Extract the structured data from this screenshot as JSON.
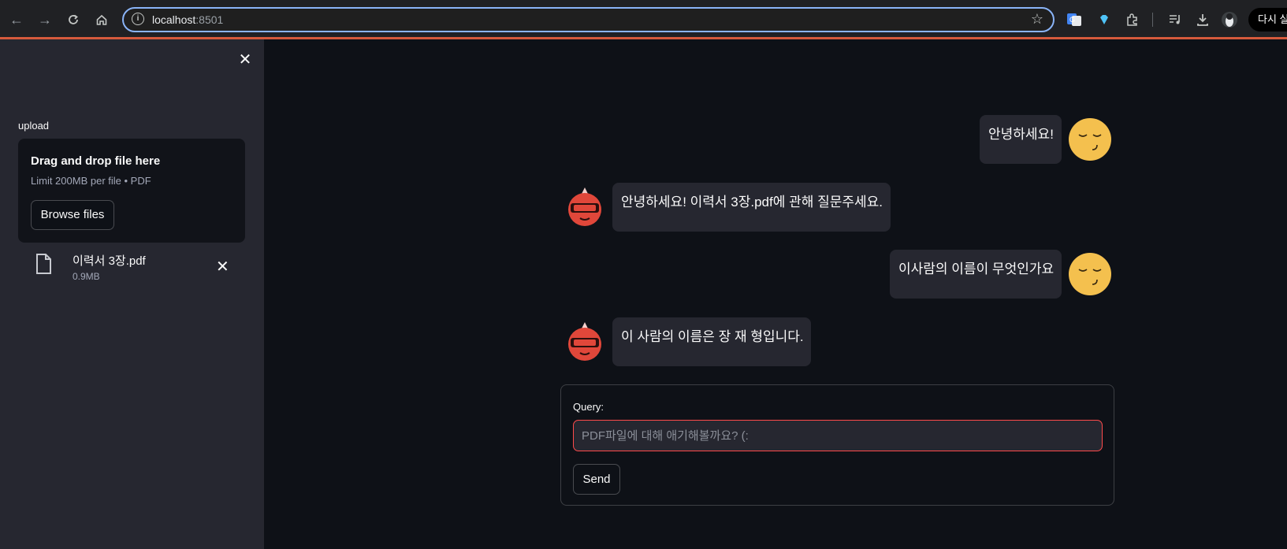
{
  "browser": {
    "url_host": "localhost",
    "url_port": ":8501",
    "relaunch_label": "다시 실"
  },
  "sidebar": {
    "upload_label": "upload",
    "dropzone_title": "Drag and drop file here",
    "dropzone_limit": "Limit 200MB per file • PDF",
    "browse_label": "Browse files",
    "file": {
      "name": "이력서 3장.pdf",
      "size": "0.9MB"
    }
  },
  "chat": {
    "messages": [
      {
        "role": "user",
        "text": "안녕하세요!"
      },
      {
        "role": "assistant",
        "text": "안녕하세요! 이력서 3장.pdf에 관해 질문주세요."
      },
      {
        "role": "user",
        "text": "이사람의 이름이 무엇인가요"
      },
      {
        "role": "assistant",
        "text": "이 사람의 이름은 장 재 형입니다."
      }
    ]
  },
  "form": {
    "query_label": "Query:",
    "query_placeholder": "PDF파일에 대해 애기해볼까요? (:",
    "query_value": "",
    "send_label": "Send"
  },
  "colors": {
    "background": "#0e1117",
    "sidebar": "#262730",
    "accent": "#ff4b4b",
    "user_avatar": "#f4c04e",
    "bot_avatar": "#e0473a"
  }
}
